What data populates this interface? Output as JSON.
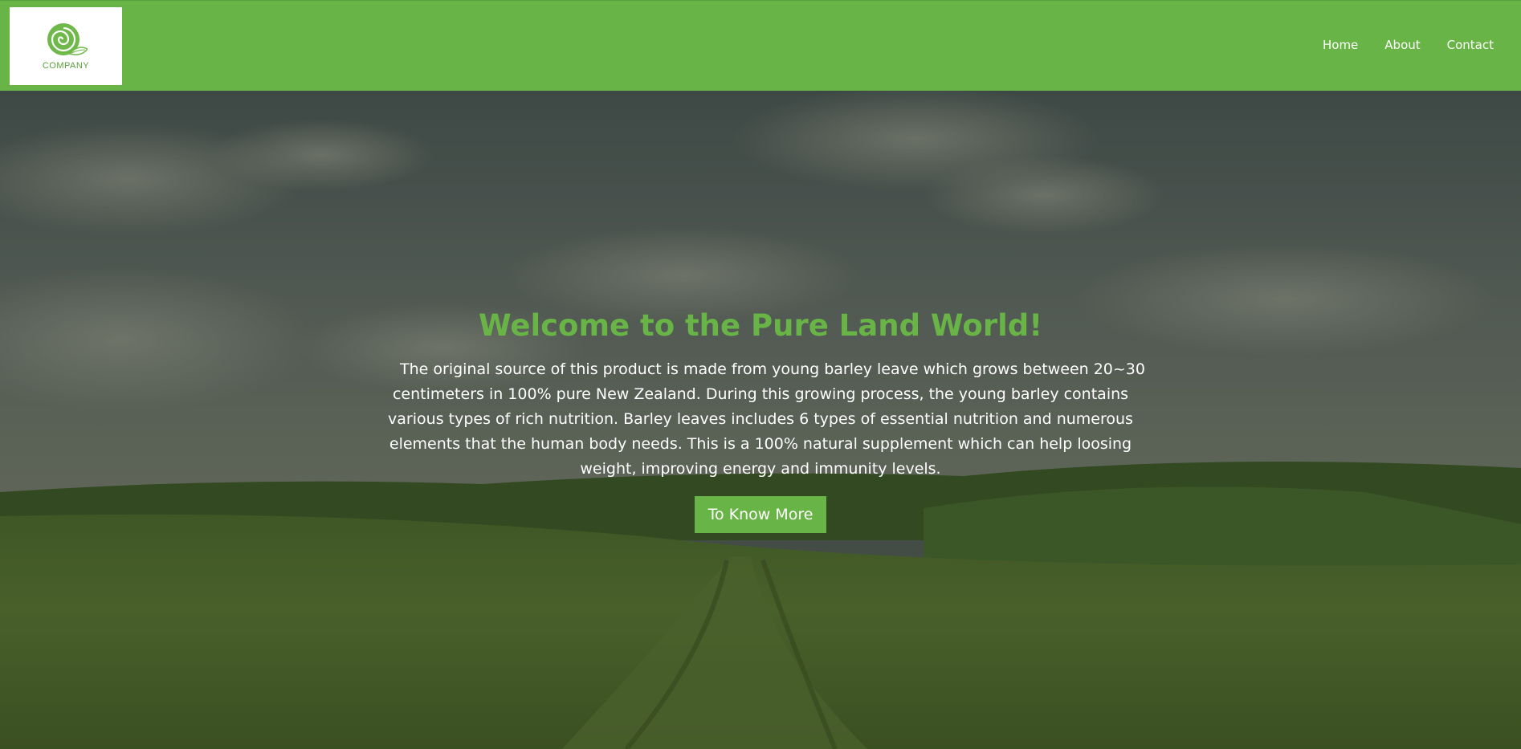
{
  "header": {
    "logo_text": "COMPANY",
    "nav": [
      {
        "label": "Home"
      },
      {
        "label": "About"
      },
      {
        "label": "Contact"
      }
    ]
  },
  "hero": {
    "title": "Welcome to the Pure Land World!",
    "description": "The original source of this product is made from young barley leave which grows between 20~30 centimeters in 100% pure New Zealand. During this growing process, the young barley contains various types of rich nutrition. Barley leaves includes 6 types of essential nutrition and numerous elements that the human body needs. This is a 100% natural supplement which can help loosing weight, improving energy and immunity levels.",
    "button_label": "To Know More"
  },
  "colors": {
    "brand_green": "#69b446",
    "text_on_hero": "#ffffff"
  },
  "icons": {
    "logo": "spiral-leaf-logo-icon"
  }
}
